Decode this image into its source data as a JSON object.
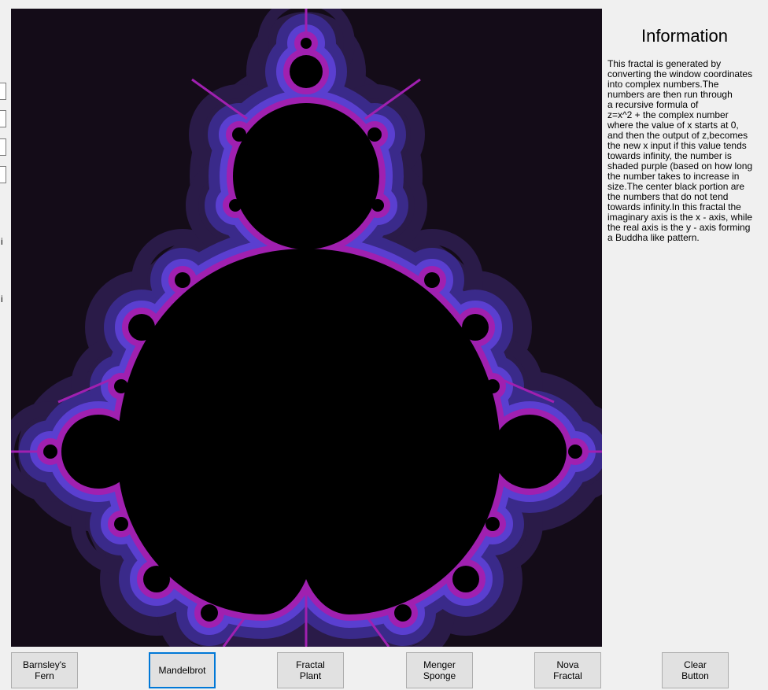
{
  "left_panel": {
    "labels": [
      "i",
      "i"
    ]
  },
  "info": {
    "title": "Information",
    "text": "This fractal is generated by\nconverting the window coordinates\ninto complex numbers.The\nnumbers are then run through\na recursive formula of\nz=x^2 + the complex number\nwhere the value of x starts at 0,\nand then the output of z,becomes\nthe new x input if this value tends\ntowards infinity, the number is\nshaded purple (based on how long\nthe number takes to increase in\nsize.The center black portion are\nthe numbers that do not tend\ntowards infinity.In this fractal the\nimaginary axis is the x - axis, while\nthe real axis is the y - axis forming\na Buddha like pattern."
  },
  "buttons": {
    "barnsley": "Barnsley's\nFern",
    "mandelbrot": "Mandelbrot",
    "fractal_plant": "Fractal\nPlant",
    "menger": "Menger\nSponge",
    "nova": "Nova\nFractal",
    "clear": "Clear\nButton"
  },
  "canvas": {
    "colors": {
      "background": "#140c18",
      "glow_outer": "#2a1b48",
      "glow_mid": "#3a2a8a",
      "glow_inner": "#5a3fd0",
      "boundary": "#a020b0",
      "interior": "#000000"
    }
  }
}
